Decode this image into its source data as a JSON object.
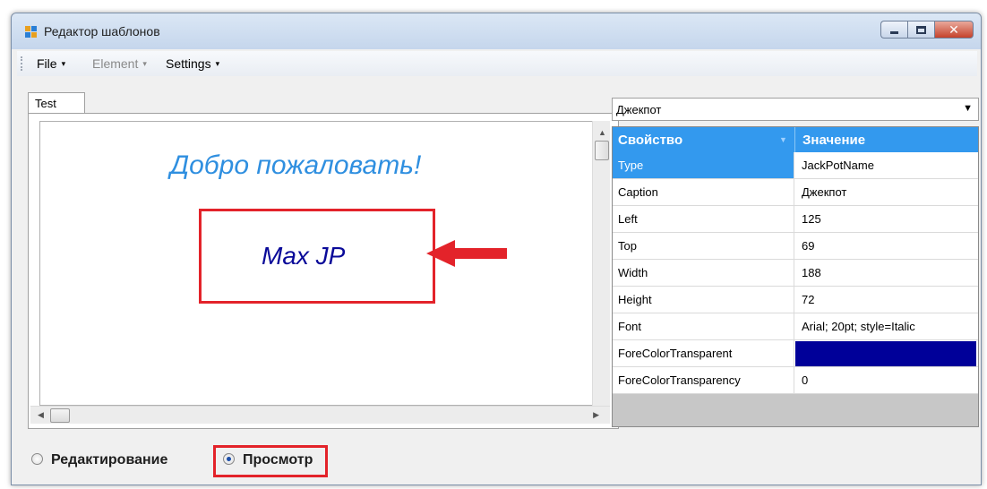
{
  "window": {
    "title": "Редактор шаблонов",
    "close_glyph": "✕"
  },
  "menu": {
    "file": "File",
    "element": "Element",
    "settings": "Settings",
    "caret": "▾"
  },
  "tab": {
    "label": "Test"
  },
  "canvas": {
    "welcome_text": "Добро пожаловать!",
    "jackpot_text": "Max JP",
    "welcome_color": "#2f8fe0",
    "jackpot_color": "#0a0a99",
    "highlight_color": "#e3232a"
  },
  "scroll": {
    "up": "▲",
    "left": "◀",
    "right": "▶"
  },
  "element_select": {
    "value": "Джекпот",
    "arrow": "▼"
  },
  "property_grid": {
    "header_property": "Свойство",
    "header_value": "Значение",
    "sort_glyph": "▼",
    "rows": [
      {
        "key": "Type",
        "value": "JackPotName"
      },
      {
        "key": "Caption",
        "value": "Джекпот"
      },
      {
        "key": "Left",
        "value": "125"
      },
      {
        "key": "Top",
        "value": "69"
      },
      {
        "key": "Width",
        "value": "188"
      },
      {
        "key": "Height",
        "value": "72"
      },
      {
        "key": "Font",
        "value": "Arial; 20pt; style=Italic"
      },
      {
        "key": "ForeColorTransparent",
        "value": "",
        "color": "#000099"
      },
      {
        "key": "ForeColorTransparency",
        "value": "0"
      }
    ]
  },
  "mode": {
    "edit_label": "Редактирование",
    "view_label": "Просмотр",
    "selected": "view"
  }
}
